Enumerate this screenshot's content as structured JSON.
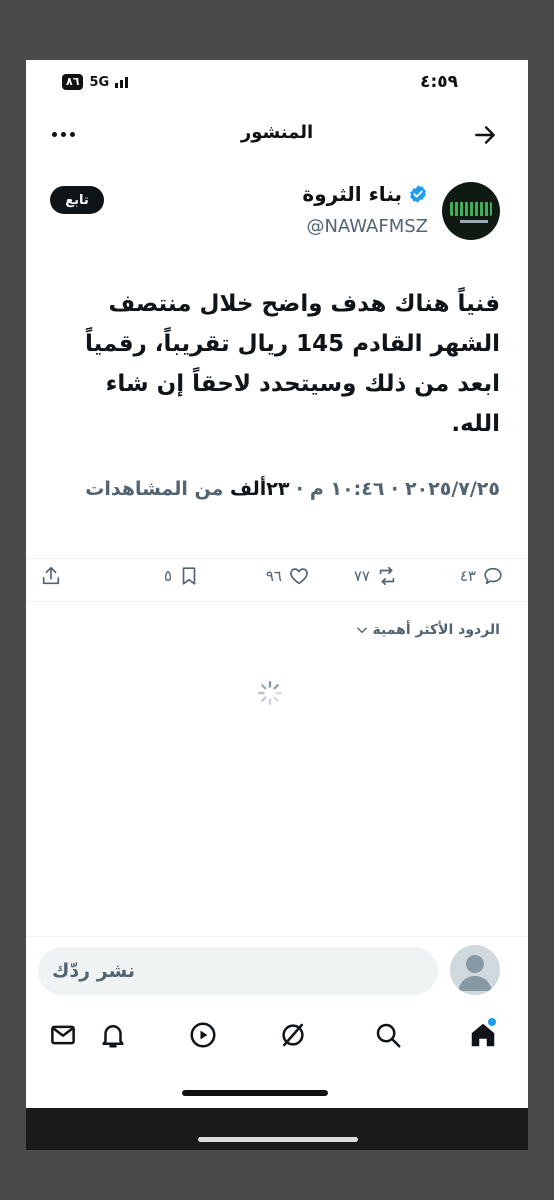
{
  "status_bar": {
    "time": "٤:٥٩",
    "battery": "٨٦",
    "network": "5G"
  },
  "header": {
    "title": "المنشور"
  },
  "post": {
    "author_name": "بناء الثروة",
    "author_handle": "@NAWAFMSZ",
    "follow_label": "تابع",
    "text": "فنياً هناك هدف واضح خلال منتصف الشهر القادم 145 ريال تقريباً، رقمياً ابعد من ذلك وسيتحدد لاحقاً إن شاء الله.",
    "timestamp": "٢٠٢٥/٧/٢٥ · ١٠:٤٦ م · ",
    "views": "٢٣ألف",
    "views_label": " من المشاهدات"
  },
  "actions": {
    "replies": "٤٣",
    "reposts": "٧٧",
    "likes": "٩٦",
    "bookmarks": "٥"
  },
  "replies_sort": {
    "label": "الردود الأكثر أهمية"
  },
  "reply_box": {
    "placeholder": "نشر ردّك"
  },
  "colors": {
    "accent": "#1d9bf0",
    "text": "#0f1419",
    "muted": "#536471"
  }
}
